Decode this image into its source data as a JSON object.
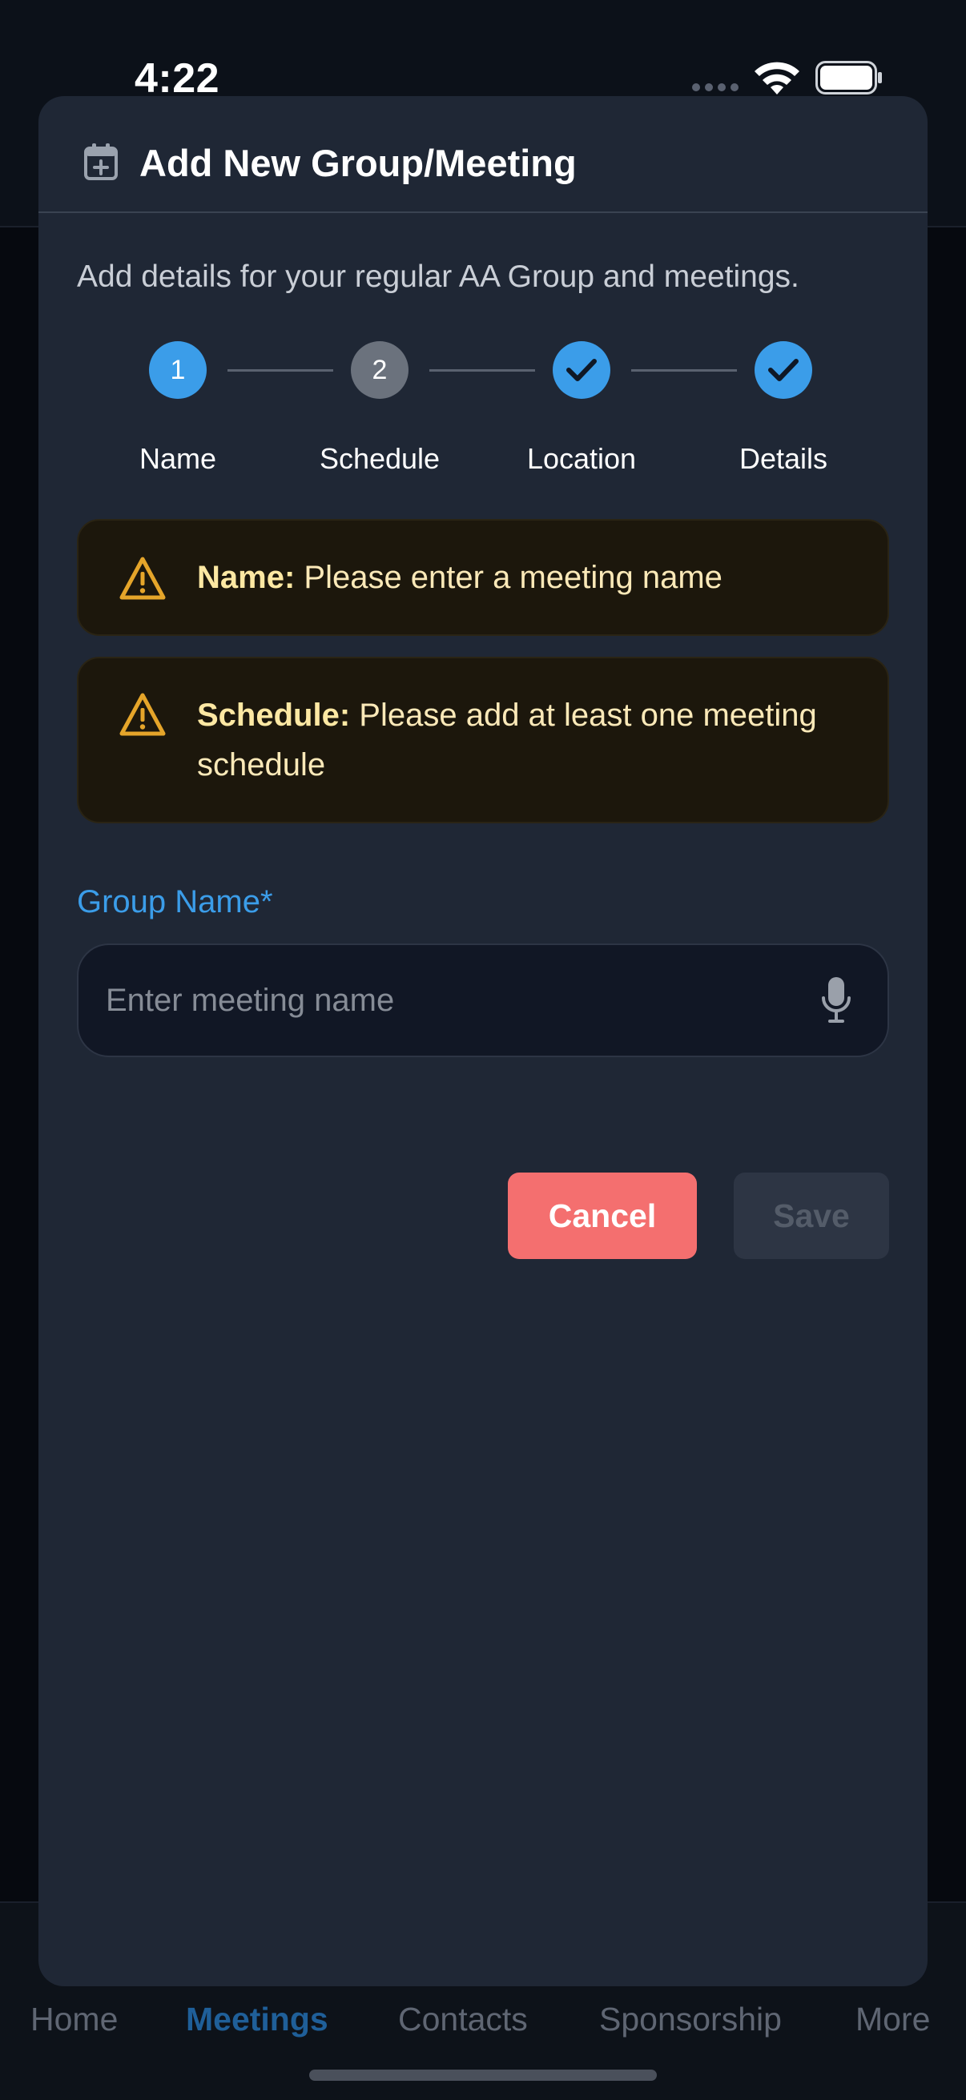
{
  "status_bar": {
    "time": "4:22"
  },
  "modal": {
    "title": "Add New Group/Meeting",
    "description": "Add details for your regular AA Group and meetings.",
    "steps": [
      {
        "label": "Name",
        "marker": "1",
        "state": "current"
      },
      {
        "label": "Schedule",
        "marker": "2",
        "state": "pending"
      },
      {
        "label": "Location",
        "marker": "check",
        "state": "complete"
      },
      {
        "label": "Details",
        "marker": "check",
        "state": "complete"
      }
    ],
    "warnings": [
      {
        "field": "Name:",
        "message": "Please enter a meeting name"
      },
      {
        "field": "Schedule:",
        "message": "Please add at least one meeting schedule"
      }
    ],
    "group_name": {
      "label": "Group Name*",
      "value": "",
      "placeholder": "Enter meeting name"
    },
    "cancel_label": "Cancel",
    "save_label": "Save"
  },
  "tab_bar": {
    "items": [
      {
        "label": "Home",
        "active": false
      },
      {
        "label": "Meetings",
        "active": true
      },
      {
        "label": "Contacts",
        "active": false
      },
      {
        "label": "Sponsorship",
        "active": false
      },
      {
        "label": "More",
        "active": false
      }
    ]
  },
  "colors": {
    "accent": "#3b9de9",
    "danger": "#f46f6f",
    "warning_icon": "#e5a52a",
    "modal_bg": "#1f2735"
  }
}
